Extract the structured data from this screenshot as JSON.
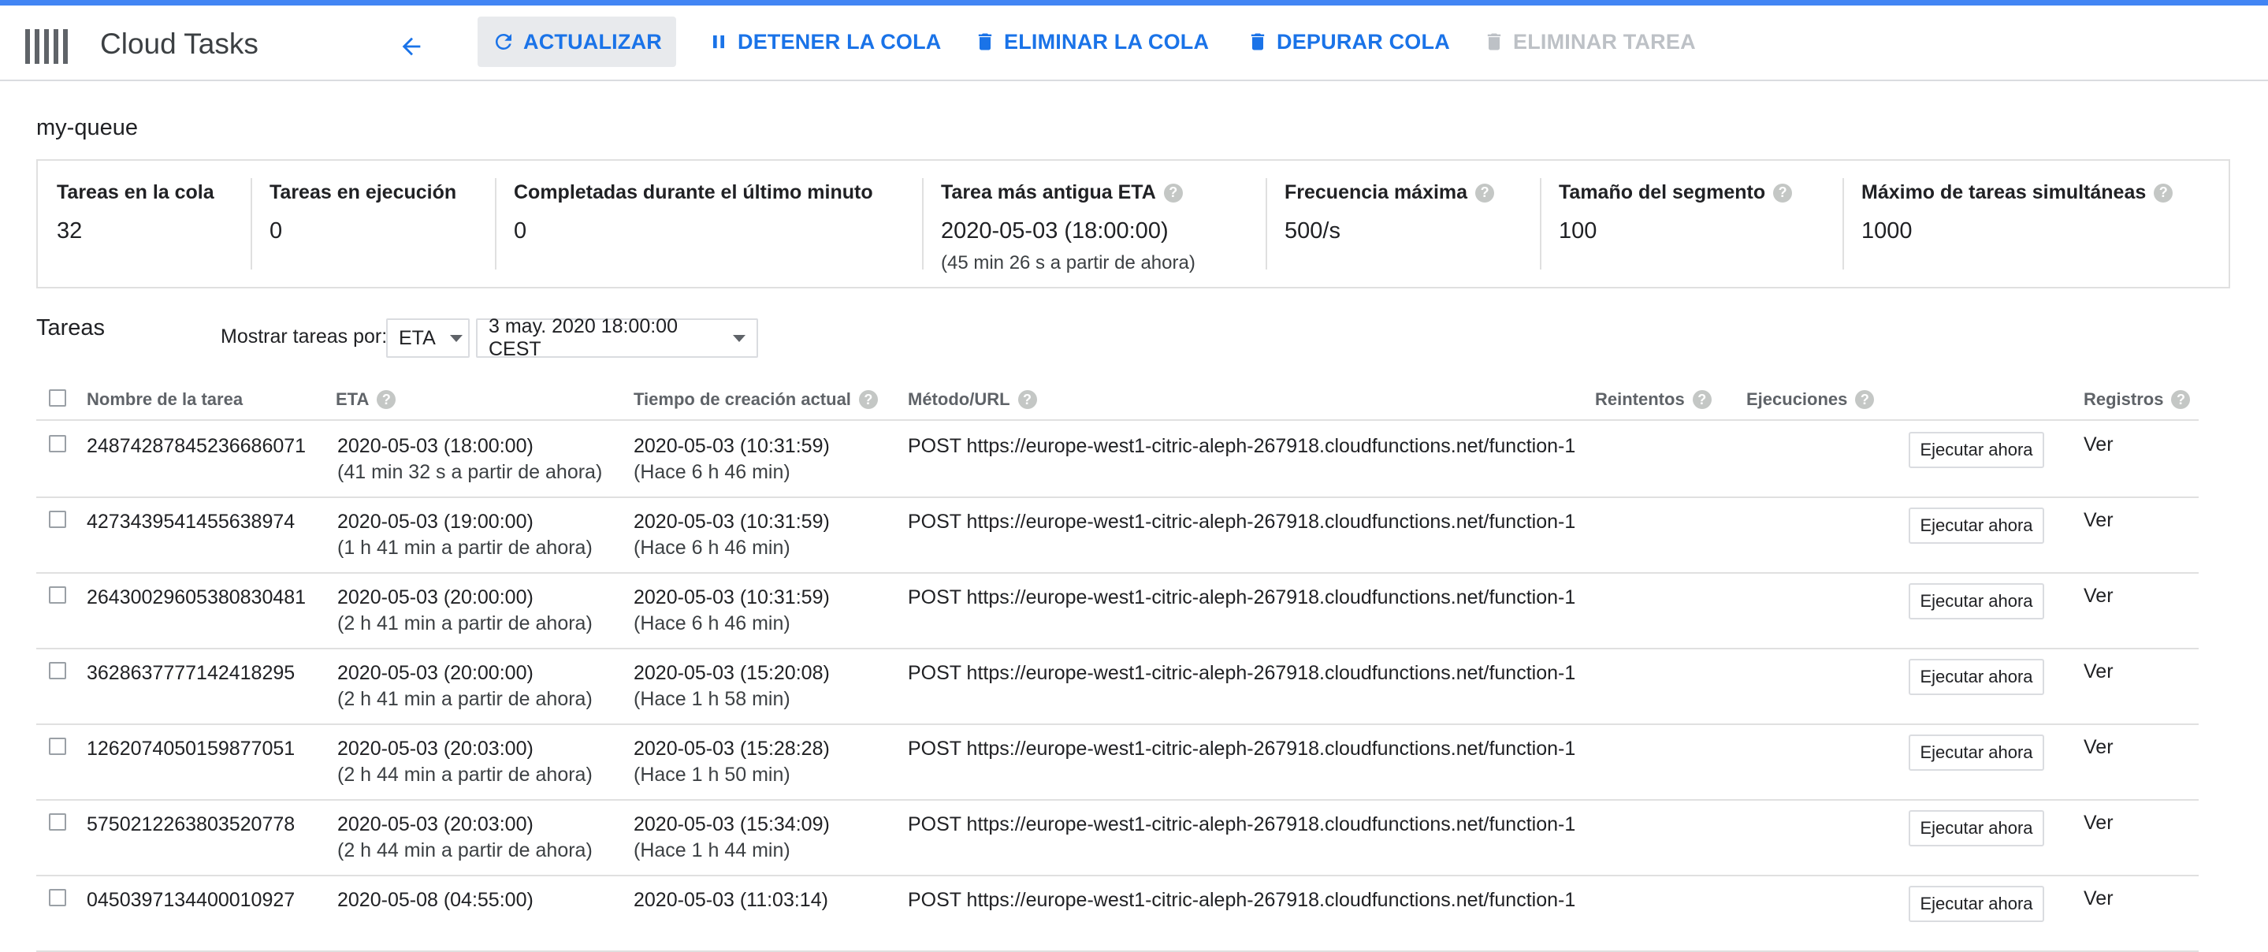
{
  "app": {
    "title": "Cloud Tasks"
  },
  "toolbar": {
    "refresh": "ACTUALIZAR",
    "pause": "DETENER LA COLA",
    "delete_queue": "ELIMINAR LA COLA",
    "purge": "DEPURAR COLA",
    "delete_task": "ELIMINAR TAREA"
  },
  "queue": {
    "name": "my-queue"
  },
  "stats": [
    {
      "label": "Tareas en la cola",
      "value": "32",
      "help": false
    },
    {
      "label": "Tareas en ejecución",
      "value": "0",
      "help": false
    },
    {
      "label": "Completadas durante el último minuto",
      "value": "0",
      "help": false
    },
    {
      "label": "Tarea más antigua ETA",
      "value": "2020-05-03 (18:00:00)",
      "sub": "(45 min 26 s a partir de ahora)",
      "help": true
    },
    {
      "label": "Frecuencia máxima",
      "value": "500/s",
      "help": true
    },
    {
      "label": "Tamaño del segmento",
      "value": "100",
      "help": true
    },
    {
      "label": "Máximo de tareas simultáneas",
      "value": "1000",
      "help": true
    }
  ],
  "tasks_section": {
    "title": "Tareas",
    "filter_label": "Mostrar tareas por:",
    "filter_field": "ETA",
    "filter_value": "3 may. 2020 18:00:00 CEST"
  },
  "table": {
    "headers": {
      "name": "Nombre de la tarea",
      "eta": "ETA",
      "created": "Tiempo de creación actual",
      "method": "Método/URL",
      "retries": "Reintentos",
      "executions": "Ejecuciones",
      "logs": "Registros"
    },
    "run_label": "Ejecutar ahora",
    "view_label": "Ver",
    "rows": [
      {
        "name": "24874287845236686071",
        "eta": "2020-05-03 (18:00:00)",
        "eta_rel": "(41 min 32 s a partir de ahora)",
        "created": "2020-05-03 (10:31:59)",
        "created_rel": "(Hace 6 h 46 min)",
        "url": "POST https://europe-west1-citric-aleph-267918.cloudfunctions.net/function-1"
      },
      {
        "name": "4273439541455638974",
        "eta": "2020-05-03 (19:00:00)",
        "eta_rel": "(1 h 41 min a partir de ahora)",
        "created": "2020-05-03 (10:31:59)",
        "created_rel": "(Hace 6 h 46 min)",
        "url": "POST https://europe-west1-citric-aleph-267918.cloudfunctions.net/function-1"
      },
      {
        "name": "26430029605380830481",
        "eta": "2020-05-03 (20:00:00)",
        "eta_rel": "(2 h 41 min a partir de ahora)",
        "created": "2020-05-03 (10:31:59)",
        "created_rel": "(Hace 6 h 46 min)",
        "url": "POST https://europe-west1-citric-aleph-267918.cloudfunctions.net/function-1"
      },
      {
        "name": "3628637777142418295",
        "eta": "2020-05-03 (20:00:00)",
        "eta_rel": "(2 h 41 min a partir de ahora)",
        "created": "2020-05-03 (15:20:08)",
        "created_rel": "(Hace 1 h 58 min)",
        "url": "POST https://europe-west1-citric-aleph-267918.cloudfunctions.net/function-1"
      },
      {
        "name": "1262074050159877051",
        "eta": "2020-05-03 (20:03:00)",
        "eta_rel": "(2 h 44 min a partir de ahora)",
        "created": "2020-05-03 (15:28:28)",
        "created_rel": "(Hace 1 h 50 min)",
        "url": "POST https://europe-west1-citric-aleph-267918.cloudfunctions.net/function-1"
      },
      {
        "name": "5750212263803520778",
        "eta": "2020-05-03 (20:03:00)",
        "eta_rel": "(2 h 44 min a partir de ahora)",
        "created": "2020-05-03 (15:34:09)",
        "created_rel": "(Hace 1 h 44 min)",
        "url": "POST https://europe-west1-citric-aleph-267918.cloudfunctions.net/function-1"
      },
      {
        "name": "0450397134400010927",
        "eta": "2020-05-08 (04:55:00)",
        "eta_rel": "",
        "created": "2020-05-03 (11:03:14)",
        "created_rel": "",
        "url": "POST https://europe-west1-citric-aleph-267918.cloudfunctions.net/function-1"
      }
    ]
  },
  "colors": {
    "accent": "#1a73e8",
    "topline": "#4285f4",
    "disabled": "#bdc1c6"
  }
}
